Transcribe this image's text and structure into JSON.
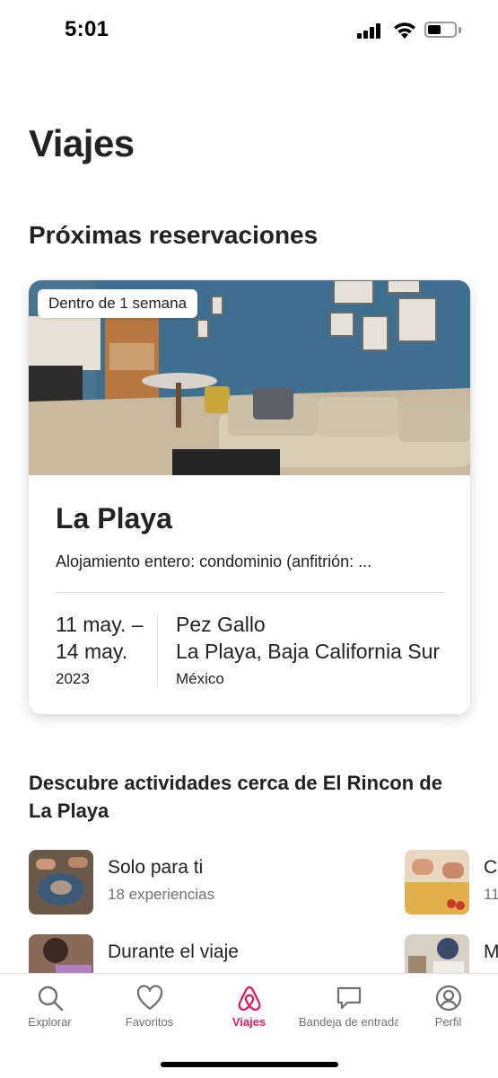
{
  "status_bar": {
    "time": "5:01"
  },
  "page": {
    "title": "Viajes"
  },
  "upcoming": {
    "section_title": "Próximas reservaciones",
    "card": {
      "badge": "Dentro de 1 semana",
      "title": "La Playa",
      "subtitle": "Alojamiento entero: condominio (anfitrión: ...",
      "date_start": "11 may. –",
      "date_end": "14 may.",
      "year": "2023",
      "place_name": "Pez Gallo",
      "place_region": "La Playa, Baja California Sur",
      "place_country": "México"
    }
  },
  "discover": {
    "title": "Descubre actividades cerca de El Rincon de La Playa",
    "items": [
      {
        "title": "Solo para ti",
        "subtitle": "18 experiencias"
      },
      {
        "title": "Durante el viaje",
        "subtitle": ""
      },
      {
        "title": "C",
        "subtitle": "11"
      },
      {
        "title": "M",
        "subtitle": ""
      }
    ]
  },
  "tab_bar": {
    "tabs": [
      {
        "label": "Explorar",
        "icon": "search-icon"
      },
      {
        "label": "Favoritos",
        "icon": "heart-icon"
      },
      {
        "label": "Viajes",
        "icon": "airbnb-logo-icon"
      },
      {
        "label": "Bandeja de entrada",
        "icon": "message-icon"
      },
      {
        "label": "Perfil",
        "icon": "profile-icon"
      }
    ],
    "active_tab": "Viajes"
  },
  "colors": {
    "accent": "#E31C5F",
    "text": "#222222",
    "muted": "#717171"
  }
}
